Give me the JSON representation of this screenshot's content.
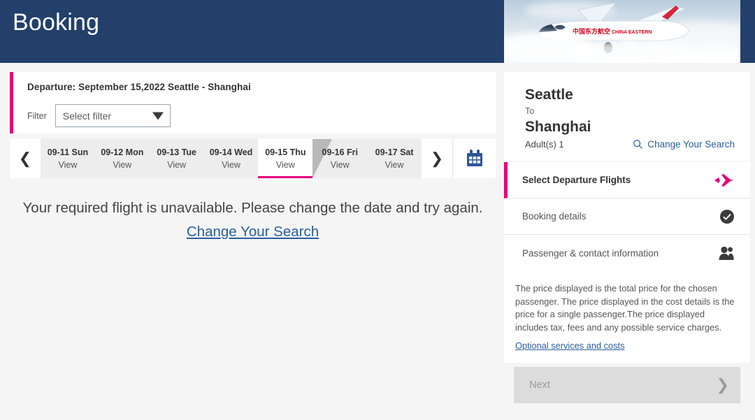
{
  "header": {
    "title": "Booking",
    "brand_navy": "#23406b",
    "hero_alt": "china-eastern-airplane"
  },
  "accent": {
    "magenta": "#e5007d",
    "link_blue": "#2a5d9f",
    "calendar_blue": "#2f5596"
  },
  "departure": {
    "title": "Departure: September 15,2022 Seattle - Shanghai",
    "filter_label": "Filter",
    "filter_value": "Select filter",
    "filter_caret": "caret-down-icon"
  },
  "date_strip": {
    "prev_label": "❮",
    "next_label": "❯",
    "calendar_icon": "calendar-icon",
    "view_label": "View",
    "tabs": [
      {
        "date": "09-11",
        "day": "Sun",
        "view": "View",
        "active": false
      },
      {
        "date": "09-12",
        "day": "Mon",
        "view": "View",
        "active": false
      },
      {
        "date": "09-13",
        "day": "Tue",
        "view": "View",
        "active": false
      },
      {
        "date": "09-14",
        "day": "Wed",
        "view": "View",
        "active": false
      },
      {
        "date": "09-15",
        "day": "Thu",
        "view": "View",
        "active": true
      },
      {
        "date": "09-16",
        "day": "Fri",
        "view": "View",
        "active": false
      },
      {
        "date": "09-17",
        "day": "Sat",
        "view": "View",
        "active": false
      }
    ]
  },
  "message": {
    "text": "Your required flight is unavailable. Please change the date and try again. ",
    "link": "Change Your Search"
  },
  "trip": {
    "origin": "Seattle",
    "to_label": "To",
    "destination": "Shanghai",
    "passengers": "Adult(s) 1",
    "change_search": "Change Your Search",
    "search_icon": "search-icon"
  },
  "steps": [
    {
      "label": "Select Departure Flights",
      "icon": "airplane-icon",
      "active": true
    },
    {
      "label": "Booking details",
      "icon": "check-circle-icon",
      "active": false
    },
    {
      "label": "Passenger & contact information",
      "icon": "people-icon",
      "active": false
    }
  ],
  "disclaimer": {
    "text": "The price displayed is the total price for the chosen passenger. The price displayed in the cost details is the price for a single passenger.The price displayed includes tax, fees and any possible service charges.",
    "link": "Optional services and costs"
  },
  "next_button": {
    "label": "Next",
    "chevron": "❯",
    "disabled": true
  }
}
